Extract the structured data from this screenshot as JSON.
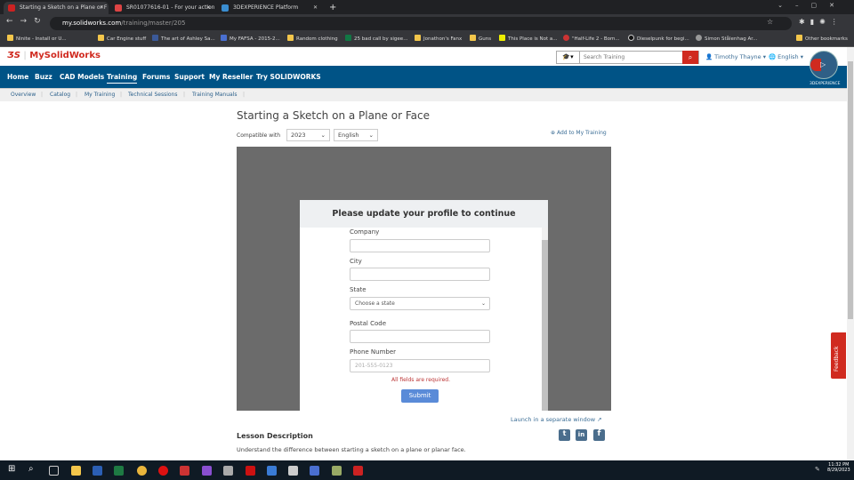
{
  "browser": {
    "tabs": [
      {
        "title": "Starting a Sketch on a Plane or F",
        "active": true
      },
      {
        "title": "SR01077616-01 - For your action"
      },
      {
        "title": "3DEXPERIENCE Platform"
      }
    ],
    "url_host": "my.solidworks.com",
    "url_path": "/training/master/205",
    "bookmarks": [
      "Ninite - Install or U...",
      "Car Engine stuff",
      "The art of Ashley Sa...",
      "My FAFSA - 2015-2...",
      "Random clothing",
      "25 bad call by sigee...",
      "Jonathon's Fanx",
      "Guns",
      "This Place is Not a...",
      "\"Half-Life 2 - Bom...",
      "Dieselpunk for begi...",
      "Simon Stålenhag Ar...",
      "Other bookmarks"
    ]
  },
  "site": {
    "logo": "MySolidWorks",
    "search_placeholder": "Search Training",
    "user": "Timothy Thayne ▾",
    "language": "English ▾",
    "platform": "3DEXPERIENCE",
    "nav": [
      "Home",
      "Buzz",
      "CAD Models",
      "Training",
      "Forums",
      "Support",
      "My Reseller",
      "Try SOLIDWORKS"
    ],
    "active_nav": "Training",
    "subnav": [
      "Overview",
      "Catalog",
      "My Training",
      "Technical Sessions",
      "Training Manuals"
    ],
    "brand_color": "#005386",
    "accent_red": "#d02a1f"
  },
  "page": {
    "title": "Starting a Sketch on a Plane or Face",
    "compatible_label": "Compatible with",
    "version": "2023",
    "language": "English",
    "add_training": "Add to My Training",
    "launch": "Launch in a separate window",
    "lesson_heading": "Lesson Description",
    "lesson_text": "Understand the difference between starting a sketch on a plane or planar face.",
    "feedback": "Feedback"
  },
  "modal": {
    "title": "Please update your profile to continue",
    "company_label": "Company",
    "city_label": "City",
    "state_label": "State",
    "state_value": "Choose a state",
    "postal_label": "Postal Code",
    "phone_label": "Phone Number",
    "phone_placeholder": "201-555-0123",
    "error": "All fields are required.",
    "submit": "Submit"
  },
  "taskbar": {
    "time": "11:32 PM",
    "date": "8/29/2023"
  }
}
